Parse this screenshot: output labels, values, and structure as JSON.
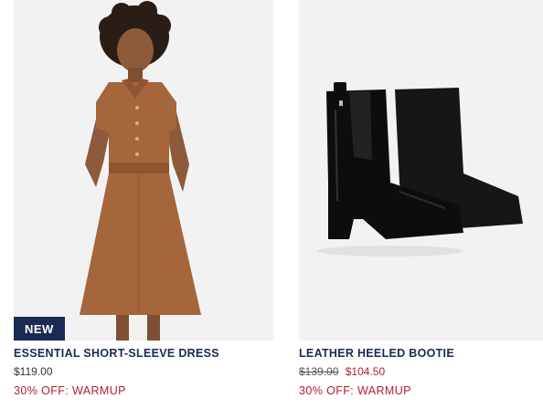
{
  "products": [
    {
      "badge": "NEW",
      "name": "ESSENTIAL SHORT-SLEEVE DRESS",
      "price": "$119.00",
      "promo": "30% OFF: WARMUP",
      "image_alt": "Brown short-sleeve shirt dress"
    },
    {
      "name": "LEATHER HEELED BOOTIE",
      "original_price": "$139.00",
      "sale_price": "$104.50",
      "promo": "30% OFF: WARMUP",
      "image_alt": "Black leather heeled ankle bootie"
    }
  ],
  "colors": {
    "navy": "#1b2a55",
    "sale_red": "#b02030",
    "dress_brown": "#a5663c"
  }
}
